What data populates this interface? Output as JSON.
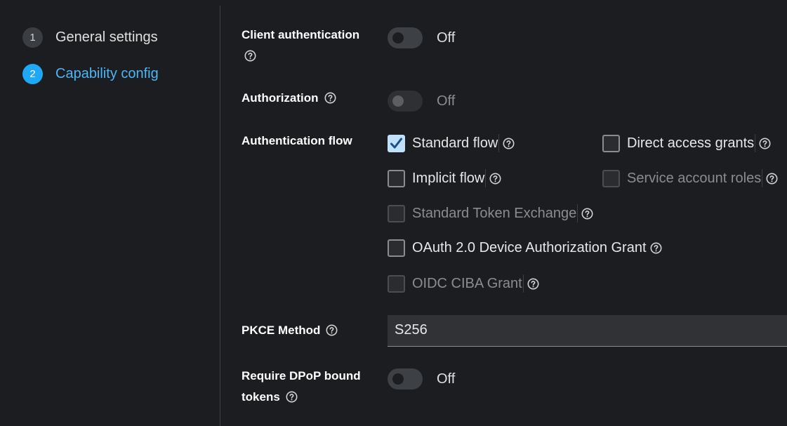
{
  "wizard": {
    "steps": [
      {
        "number": "1",
        "label": "General settings"
      },
      {
        "number": "2",
        "label": "Capability config"
      }
    ]
  },
  "form": {
    "client_authentication": {
      "label": "Client authentication",
      "state": "Off"
    },
    "authorization": {
      "label": "Authorization",
      "state": "Off"
    },
    "authentication_flow": {
      "label": "Authentication flow",
      "options": {
        "standard_flow": "Standard flow",
        "direct_access_grants": "Direct access grants",
        "implicit_flow": "Implicit flow",
        "service_account_roles": "Service account roles",
        "standard_token_exchange": "Standard Token Exchange",
        "oauth_device_grant": "OAuth 2.0 Device Authorization Grant",
        "oidc_ciba_grant": "OIDC CIBA Grant"
      }
    },
    "pkce_method": {
      "label": "PKCE Method",
      "value": "S256"
    },
    "dpop": {
      "label_line1": "Require DPoP bound",
      "label_line2": "tokens",
      "state": "Off"
    }
  },
  "colors": {
    "accent": "#1fa7f8",
    "background": "#1b1d21",
    "checked": "#bfe1fb"
  }
}
